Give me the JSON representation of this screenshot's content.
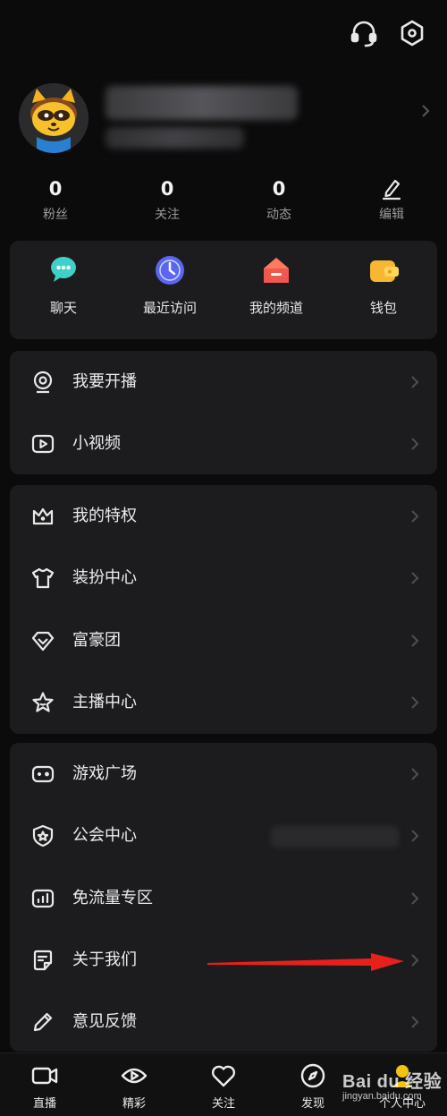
{
  "header": {
    "support_icon": "headset-icon",
    "settings_icon": "hexagon-settings-icon"
  },
  "stats": [
    {
      "value": "0",
      "label": "粉丝"
    },
    {
      "value": "0",
      "label": "关注"
    },
    {
      "value": "0",
      "label": "动态"
    }
  ],
  "edit": {
    "label": "编辑",
    "icon": "pencil-edit-icon"
  },
  "quick": [
    {
      "label": "聊天",
      "icon": "chat-bubble-icon",
      "color": "#3fd0c8"
    },
    {
      "label": "最近访问",
      "icon": "clock-icon",
      "color": "#5a66f0"
    },
    {
      "label": "我的频道",
      "icon": "house-icon",
      "color": "#f0584f"
    },
    {
      "label": "钱包",
      "icon": "wallet-icon",
      "color": "#f7b733"
    }
  ],
  "menu1": [
    {
      "label": "我要开播",
      "icon": "webcam-icon"
    },
    {
      "label": "小视频",
      "icon": "video-play-icon"
    }
  ],
  "menu2": [
    {
      "label": "我的特权",
      "icon": "crown-icon"
    },
    {
      "label": "装扮中心",
      "icon": "tshirt-icon"
    },
    {
      "label": "富豪团",
      "icon": "diamond-icon"
    },
    {
      "label": "主播中心",
      "icon": "star-icon"
    }
  ],
  "menu3": [
    {
      "label": "游戏广场",
      "icon": "gamepad-icon"
    },
    {
      "label": "公会中心",
      "icon": "shield-star-icon"
    },
    {
      "label": "免流量专区",
      "icon": "signal-bars-icon"
    },
    {
      "label": "关于我们",
      "icon": "note-icon"
    },
    {
      "label": "意见反馈",
      "icon": "pencil-icon"
    }
  ],
  "annotation": {
    "arrow_color": "#e8201c"
  },
  "tabbar": [
    {
      "label": "直播",
      "icon": "video-camera-icon"
    },
    {
      "label": "精彩",
      "icon": "eye-play-icon"
    },
    {
      "label": "关注",
      "icon": "heart-icon"
    },
    {
      "label": "发现",
      "icon": "compass-icon"
    },
    {
      "label": "个人中心",
      "icon": "person-icon"
    }
  ],
  "watermark": {
    "brand": "Bai du 经验",
    "url": "jingyan.baidu.com"
  }
}
